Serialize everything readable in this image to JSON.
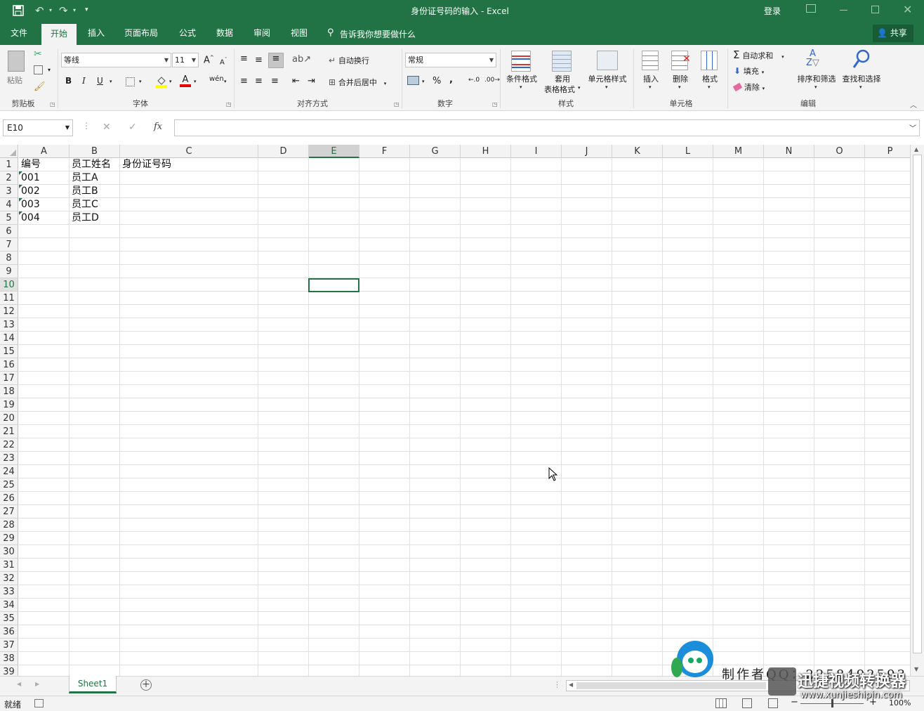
{
  "window": {
    "title": "身份证号码的输入 - Excel",
    "login": "登录"
  },
  "tabs": [
    "文件",
    "开始",
    "插入",
    "页面布局",
    "公式",
    "数据",
    "审阅",
    "视图"
  ],
  "tell_me": "告诉我你想要做什么",
  "share": "共享",
  "ribbon": {
    "clipboard": {
      "label": "剪贴板",
      "paste": "粘贴"
    },
    "font": {
      "label": "字体",
      "name": "等线",
      "size": "11",
      "bold": "B",
      "italic": "I",
      "underline": "U"
    },
    "alignment": {
      "label": "对齐方式",
      "wrap": "自动换行",
      "merge": "合并后居中"
    },
    "number": {
      "label": "数字",
      "format": "常规",
      "percent": "%",
      "comma": ","
    },
    "styles": {
      "label": "样式",
      "conditional": "条件格式",
      "table1": "套用",
      "table2": "表格格式",
      "cell_styles": "单元格样式"
    },
    "cells": {
      "label": "单元格",
      "insert": "插入",
      "delete": "删除",
      "format": "格式"
    },
    "editing": {
      "label": "编辑",
      "autosum": "自动求和",
      "fill": "填充",
      "clear": "清除",
      "sort": "排序和筛选",
      "find": "查找和选择"
    }
  },
  "formula_bar": {
    "name_box": "E10",
    "fx": "fx",
    "value": ""
  },
  "columns": [
    "A",
    "B",
    "C",
    "D",
    "E",
    "F",
    "G",
    "H",
    "I",
    "J",
    "K",
    "L",
    "M",
    "N",
    "O",
    "P"
  ],
  "selected_col": "E",
  "selected_row": 10,
  "row_count": 39,
  "cells": {
    "A1": "编号",
    "B1": "员工姓名",
    "C1": "身份证号码",
    "A2": "001",
    "B2": "员工A",
    "A3": "002",
    "B3": "员工B",
    "A4": "003",
    "B4": "员工C",
    "A5": "004",
    "B5": "员工D"
  },
  "sheet_tab": "Sheet1",
  "status": {
    "ready": "就绪",
    "zoom": "100%"
  },
  "watermark": {
    "text": "制作者QQ：2258492593",
    "brand": "迅捷视频转换器",
    "url": "www.xunjieshipin.com"
  }
}
